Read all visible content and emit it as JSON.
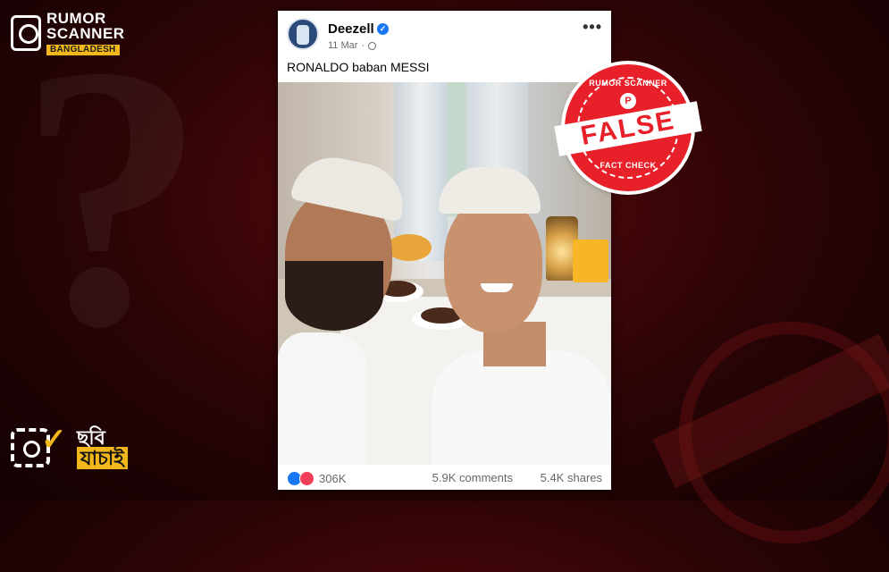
{
  "brand": {
    "line1": "RUMOR",
    "line2": "SCANNER",
    "line3": "BANGLADESH",
    "icon": "phone-check-icon",
    "accent_color": "#f2b71a"
  },
  "photo_check": {
    "line1": "ছবি",
    "line2": "যাচাই",
    "icon": "camera-check-icon"
  },
  "post": {
    "author": "Deezell",
    "verified_icon": "verified-badge-icon",
    "date": "11 Mar",
    "privacy_icon": "globe-icon",
    "more_label": "•••",
    "caption": "RONALDO baban MESSI",
    "reactions_count": "306K",
    "comments": "5.9K comments",
    "shares": "5.4K shares"
  },
  "stamp": {
    "top_text": "RUMOR SCANNER",
    "label": "FALSE",
    "bottom_text": "FACT CHECK",
    "letter": "P",
    "color": "#e8202a"
  }
}
